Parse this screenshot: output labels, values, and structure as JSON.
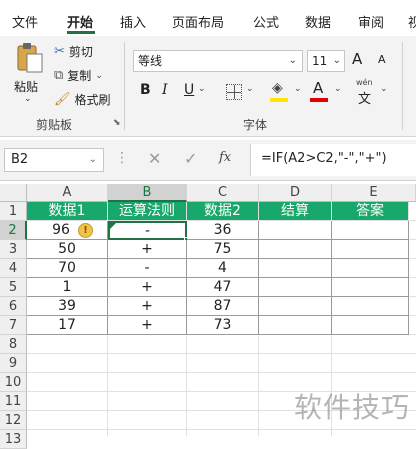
{
  "tabs": [
    "文件",
    "开始",
    "插入",
    "页面布局",
    "公式",
    "数据",
    "审阅",
    "视"
  ],
  "clipboard": {
    "paste": "粘贴",
    "cut": "剪切",
    "copy": "复制",
    "format_painter": "格式刷",
    "group": "剪贴板"
  },
  "font": {
    "name": "等线",
    "size": "11",
    "bold": "B",
    "italic": "I",
    "underline": "U",
    "group": "字体",
    "grow": "A",
    "shrink": "A",
    "wen": "wén",
    "wen_char": "文"
  },
  "formula_bar": {
    "name_box": "B2",
    "fx": "fx",
    "formula": "=IF(A2>C2,\"-\",\"+\")"
  },
  "columns": [
    "A",
    "B",
    "C",
    "D",
    "E"
  ],
  "rows": [
    "1",
    "2",
    "3",
    "4",
    "5",
    "6",
    "7",
    "8",
    "9",
    "10",
    "11",
    "12",
    "13"
  ],
  "table": {
    "headers": [
      "数据1",
      "运算法则",
      "数据2",
      "结算",
      "答案"
    ],
    "rows": [
      [
        "96",
        "-",
        "36",
        "",
        ""
      ],
      [
        "50",
        "+",
        "75",
        "",
        ""
      ],
      [
        "70",
        "-",
        "4",
        "",
        ""
      ],
      [
        "1",
        "+",
        "47",
        "",
        ""
      ],
      [
        "39",
        "+",
        "87",
        "",
        ""
      ],
      [
        "17",
        "+",
        "73",
        "",
        ""
      ]
    ]
  },
  "colors": {
    "header_green": "#19a86b",
    "accent": "#217346",
    "fill_yellow": "#ffe600",
    "font_red": "#e00000"
  },
  "watermark": "软件技巧"
}
